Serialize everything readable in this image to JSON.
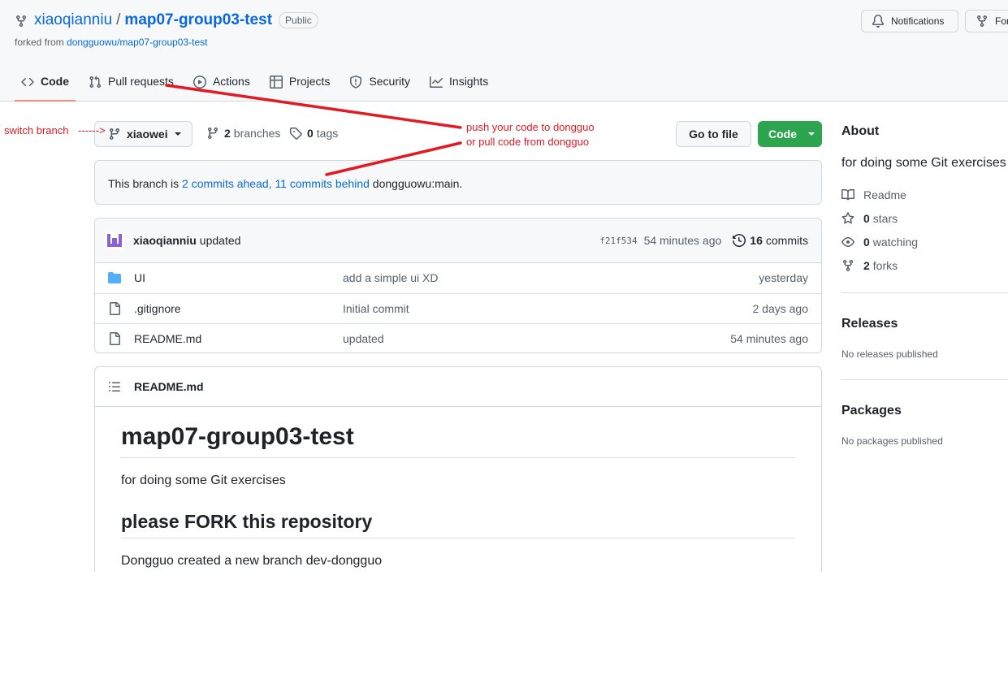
{
  "repo": {
    "owner": "xiaoqianniu",
    "separator": "/",
    "name": "map07-group03-test",
    "visibility": "Public",
    "forked_prefix": "forked from ",
    "forked_source": "dongguowu/map07-group03-test"
  },
  "header_buttons": {
    "notifications": "Notifications",
    "fork": "Fork"
  },
  "tabs": [
    {
      "label": "Code",
      "icon": "code-icon",
      "active": true
    },
    {
      "label": "Pull requests",
      "icon": "pull-request-icon"
    },
    {
      "label": "Actions",
      "icon": "play-icon"
    },
    {
      "label": "Projects",
      "icon": "table-icon"
    },
    {
      "label": "Security",
      "icon": "shield-icon"
    },
    {
      "label": "Insights",
      "icon": "graph-icon"
    }
  ],
  "branch_bar": {
    "branch": "xiaowei",
    "branches_count": "2",
    "branches_label": "branches",
    "tags_count": "0",
    "tags_label": "tags",
    "go_to_file": "Go to file",
    "code": "Code"
  },
  "ahead_banner": {
    "prefix": "This branch is ",
    "ahead_link": "2 commits ahead,",
    "behind_link": "11 commits behind",
    "suffix": " dongguowu:main."
  },
  "latest_commit": {
    "author": "xiaoqianniu",
    "message": "updated",
    "sha": "f21f534",
    "age": "54 minutes ago",
    "commit_count": "16",
    "commits_label": "commits"
  },
  "files": [
    {
      "name": "UI",
      "type": "folder",
      "message": "add a simple ui XD",
      "age": "yesterday"
    },
    {
      "name": ".gitignore",
      "type": "file",
      "message": "Initial commit",
      "age": "2 days ago"
    },
    {
      "name": "README.md",
      "type": "file",
      "message": "updated",
      "age": "54 minutes ago"
    }
  ],
  "readme": {
    "filename": "README.md",
    "h1": "map07-group03-test",
    "p1": "for doing some Git exercises",
    "h2": "please FORK this repository",
    "p2": "Dongguo created a new branch dev-dongguo"
  },
  "sidebar": {
    "about_title": "About",
    "description": "for doing some Git exercises",
    "readme": "Readme",
    "stars_count": "0",
    "stars_label": "stars",
    "watching_count": "0",
    "watching_label": "watching",
    "forks_count": "2",
    "forks_label": "forks",
    "releases_title": "Releases",
    "releases_sub": "No releases published",
    "packages_title": "Packages",
    "packages_sub": "No packages published"
  },
  "annotations": {
    "switch_branch": "switch branch",
    "arrow": "------>",
    "push_line1": "push your code to dongguo",
    "push_line2": "or pull code from dongguo",
    "color": "#e01b24"
  }
}
